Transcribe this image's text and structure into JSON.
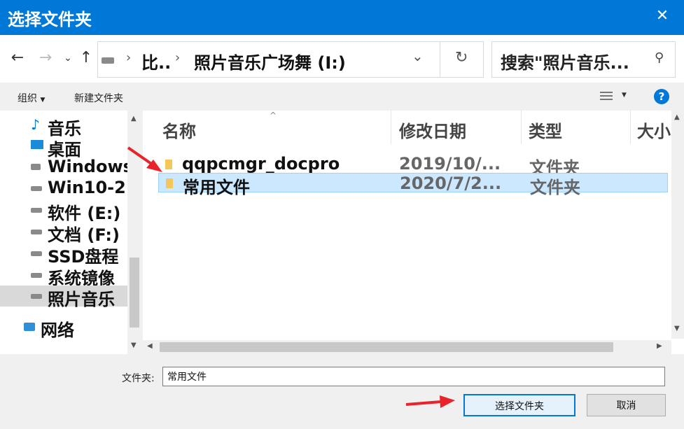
{
  "window": {
    "title": "选择文件夹"
  },
  "address": {
    "crumbs": [
      "比..",
      "照片音乐广场舞 (I:)"
    ],
    "separator": "›",
    "dropdown": "⌄",
    "refresh": "↻",
    "search_placeholder": "搜索\"照片音乐..."
  },
  "toolbar": {
    "organize": "组织",
    "new_folder": "新建文件夹"
  },
  "nav": {
    "items": [
      {
        "label": "音乐",
        "icon": "music-icon"
      },
      {
        "label": "桌面",
        "icon": "desktop-icon"
      },
      {
        "label": "Windows",
        "icon": "windows-drive-icon"
      },
      {
        "label": "Win10-2",
        "icon": "drive-icon"
      },
      {
        "label": "软件 (E:)",
        "icon": "drive-icon"
      },
      {
        "label": "文档 (F:)",
        "icon": "drive-icon"
      },
      {
        "label": "SSD盘程",
        "icon": "drive-icon"
      },
      {
        "label": "系统镜像",
        "icon": "drive-icon"
      },
      {
        "label": "照片音乐",
        "icon": "drive-icon"
      },
      {
        "label": "网络",
        "icon": "network-icon"
      }
    ]
  },
  "files": {
    "columns": [
      "名称",
      "修改日期",
      "类型",
      "大小"
    ],
    "rows": [
      {
        "name": "qqpcmgr_docpro",
        "date": "2019/10/...",
        "type": "文件夹"
      },
      {
        "name": "常用文件",
        "date": "2020/7/2...",
        "type": "文件夹"
      }
    ]
  },
  "bottom": {
    "folder_label": "文件夹:",
    "folder_value": "常用文件",
    "select": "选择文件夹",
    "cancel": "取消"
  },
  "colors": {
    "accent": "#0078d7",
    "selected": "#cce8ff",
    "arrow": "#e8242a"
  }
}
